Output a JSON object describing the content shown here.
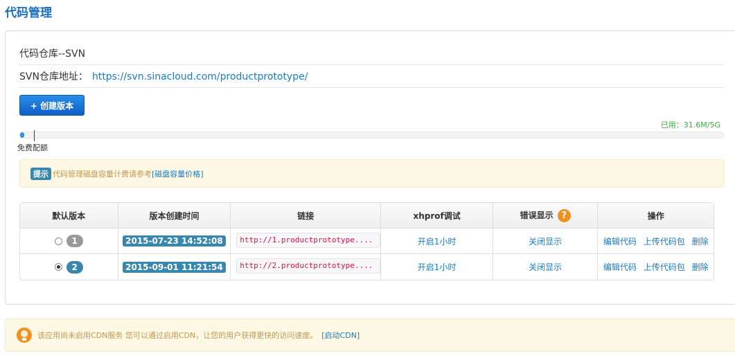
{
  "page": {
    "title": "代码管理"
  },
  "repo": {
    "title": "代码仓库--SVN",
    "address_label": "SVN仓库地址：",
    "address_url": "https://svn.sinacloud.com/productprototype/"
  },
  "toolbar": {
    "create_label": "+ 创建版本"
  },
  "usage": {
    "used_label": "已用：31.6M/5G",
    "quota_label": "免费配额",
    "used_fraction": 0.006
  },
  "tip": {
    "badge": "提示",
    "text": "代码管理磁盘容量计费请参考",
    "link": "[磁盘容量价格]"
  },
  "table": {
    "headers": [
      "默认版本",
      "版本创建时间",
      "链接",
      "xhprof调试",
      "错误显示",
      "操作"
    ],
    "rows": [
      {
        "checked": false,
        "version": "1",
        "created": "2015-07-23 14:52:08",
        "link": "http://1.productprototype....",
        "xhprof": "开启1小时",
        "error": "关闭显示",
        "ops": [
          "编辑代码",
          "上传代码包",
          "删除"
        ]
      },
      {
        "checked": true,
        "version": "2",
        "created": "2015-09-01 11:21:54",
        "link": "http://2.productprototype....",
        "xhprof": "开启1小时",
        "error": "关闭显示",
        "ops": [
          "编辑代码",
          "上传代码包",
          "删除"
        ]
      }
    ]
  },
  "cdn": {
    "text": "该应用尚未启用CDN服务 您可以通过启用CDN，让您的用户获得更快的访问速度。",
    "link": "[启动CDN]"
  },
  "colors": {
    "accent": "#1a6fc2",
    "link": "#1a7bbf",
    "badge_blue": "#3a87ad",
    "warn_bg": "#fcf8e3",
    "help_orange": "#f0901e"
  }
}
